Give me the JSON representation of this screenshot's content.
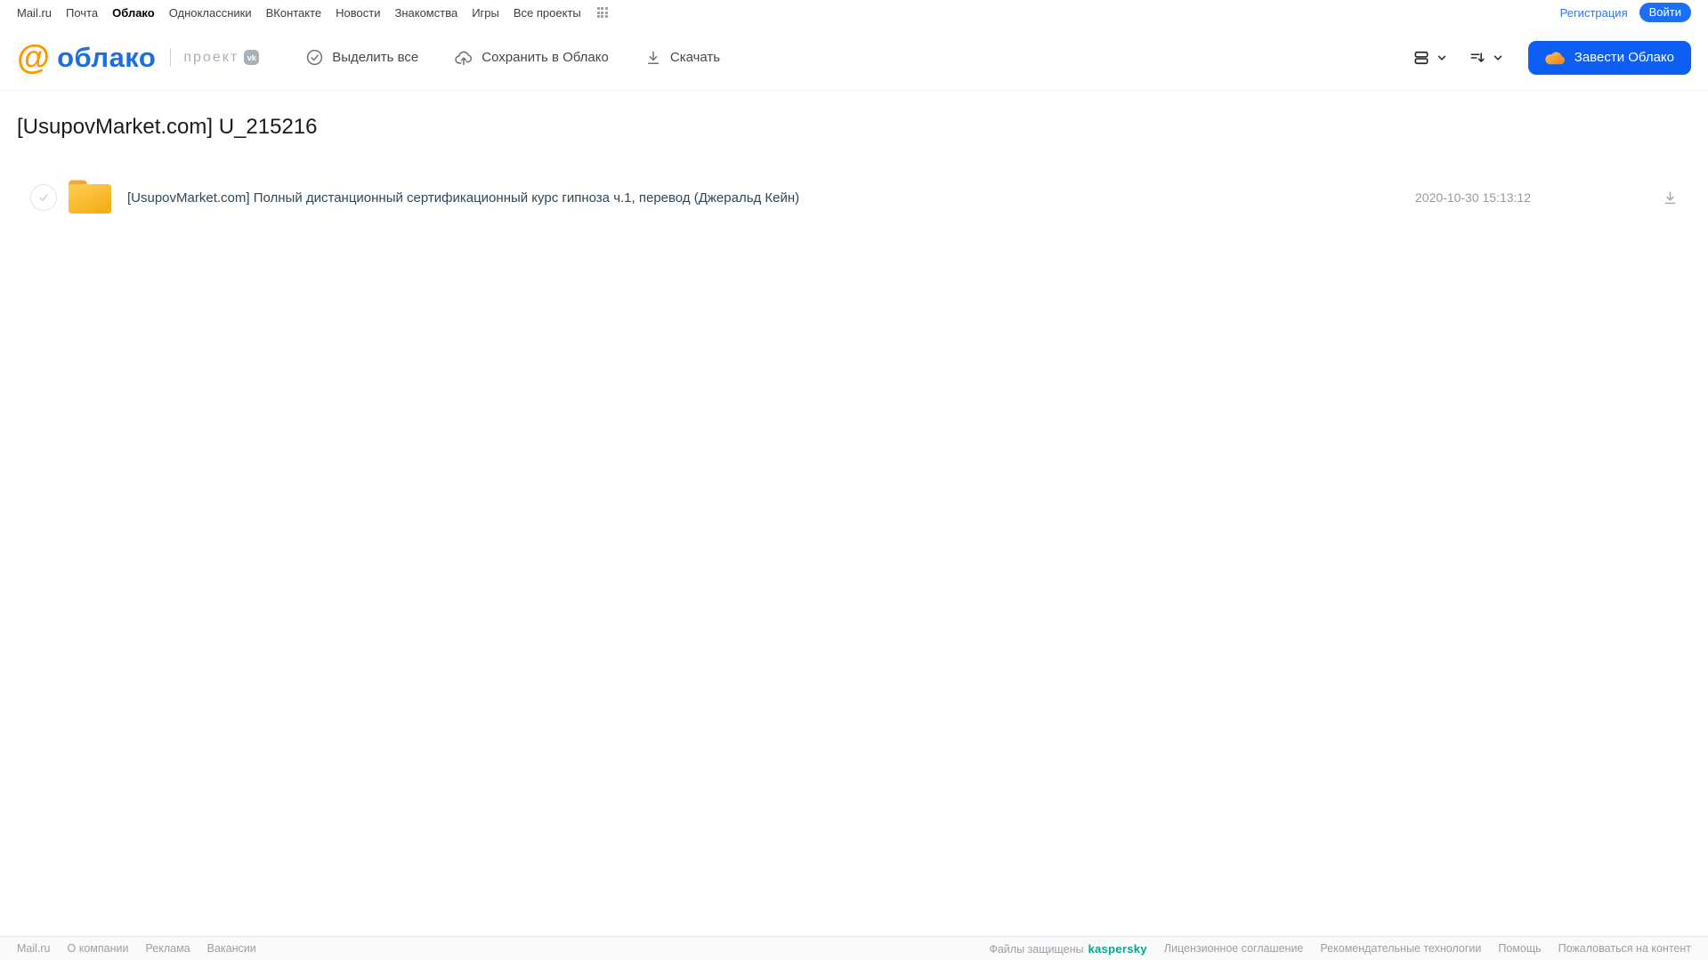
{
  "portal_nav": {
    "items": [
      "Mail.ru",
      "Почта",
      "Облако",
      "Одноклассники",
      "ВКонтакте",
      "Новости",
      "Знакомства",
      "Игры",
      "Все проекты"
    ],
    "active_item": "Облако",
    "register_label": "Регистрация",
    "login_label": "Войти"
  },
  "header": {
    "logo_at": "@",
    "logo_text": "облако",
    "project_label": "проект",
    "vk_badge": "vk",
    "actions": {
      "select_all": "Выделить все",
      "save_to_cloud": "Сохранить в Облако",
      "download": "Скачать"
    },
    "get_cloud_button": "Завести Облако"
  },
  "main": {
    "title": "[UsupovMarket.com] U_215216",
    "files": [
      {
        "type": "folder",
        "name": "[UsupovMarket.com] Полный дистанционный сертификационный курс гипноза ч.1, перевод (Джеральд Кейн)",
        "date": "2020-10-30 15:13:12"
      }
    ]
  },
  "footer": {
    "left_links": [
      "Mail.ru",
      "О компании",
      "Реклама",
      "Вакансии"
    ],
    "protected_text": "Файлы защищены",
    "kaspersky_label": "kaspersky",
    "right_links": [
      "Лицензионное соглашение",
      "Рекомендательные технологии",
      "Помощь",
      "Пожаловаться на контент"
    ]
  },
  "colors": {
    "accent_blue": "#0d5ef5",
    "logo_blue": "#1d6fe0",
    "logo_orange": "#ff9800",
    "folder_yellow_light": "#ffce55",
    "folder_yellow_dark": "#f6ae17",
    "folder_tab": "#f3a838",
    "kaspersky_teal": "#00a88e"
  }
}
